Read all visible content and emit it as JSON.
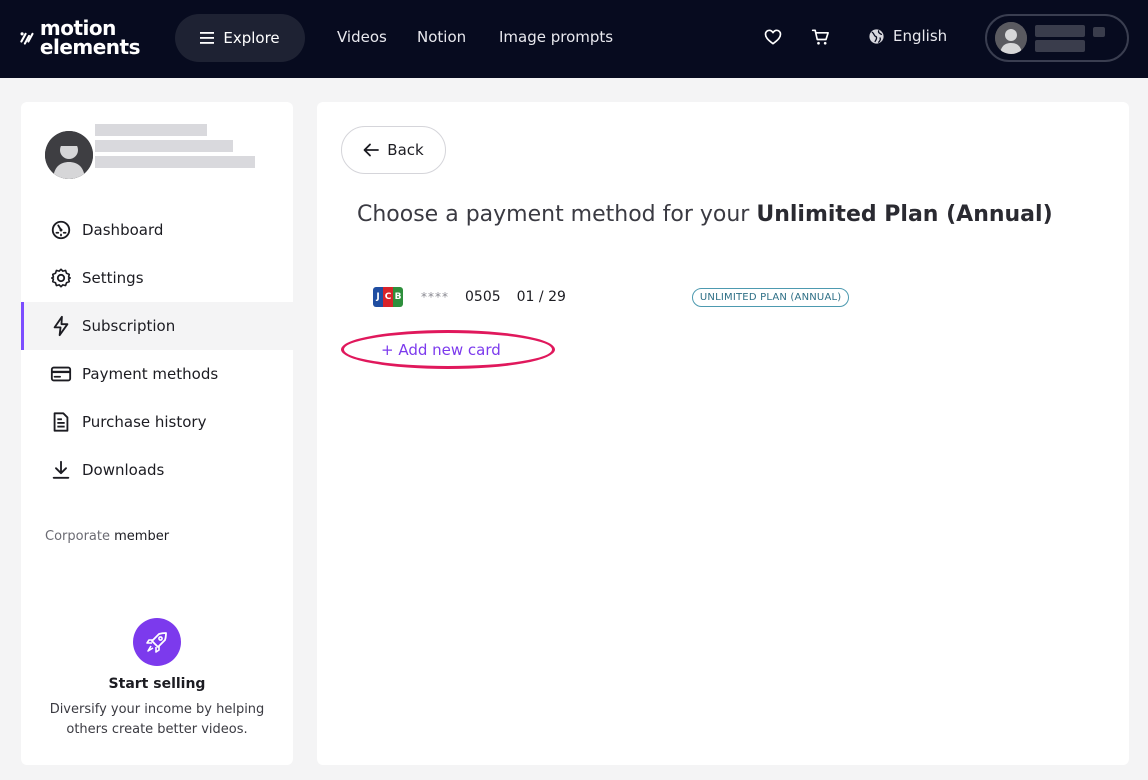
{
  "header": {
    "logo": {
      "line1": "motion",
      "line2": "elements"
    },
    "explore_label": "Explore",
    "nav_links": [
      "Videos",
      "Notion",
      "Image prompts"
    ],
    "language": "English",
    "icons": [
      "menu-icon",
      "heart-icon",
      "cart-icon",
      "globe-icon",
      "avatar-icon"
    ]
  },
  "sidebar": {
    "menu": [
      {
        "label": "Dashboard",
        "icon": "dashboard-icon",
        "active": false
      },
      {
        "label": "Settings",
        "icon": "gear-icon",
        "active": false
      },
      {
        "label": "Subscription",
        "icon": "lightning-icon",
        "active": true
      },
      {
        "label": "Payment methods",
        "icon": "credit-card-icon",
        "active": false
      },
      {
        "label": "Purchase history",
        "icon": "receipt-icon",
        "active": false
      },
      {
        "label": "Downloads",
        "icon": "download-icon",
        "active": false
      }
    ],
    "corporate_prefix": "Corporate",
    "corporate_suffix": "member",
    "sell": {
      "title": "Start selling",
      "description": "Diversify your income by helping others create better videos.",
      "icon": "rocket-icon"
    }
  },
  "main": {
    "back_label": "Back",
    "heading_prefix": "Choose a payment method for your",
    "heading_plan": "Unlimited Plan (Annual)",
    "card": {
      "brand": "JCB",
      "mask": "****",
      "last4": "0505",
      "expiry": "01 / 29",
      "badge": "UNLIMITED PLAN (ANNUAL)"
    },
    "add_card_label": "+ Add new card"
  },
  "colors": {
    "topbar": "#070b1f",
    "accent": "#7c3aed",
    "annotation": "#e0185c",
    "badge": "#2e6f86"
  }
}
